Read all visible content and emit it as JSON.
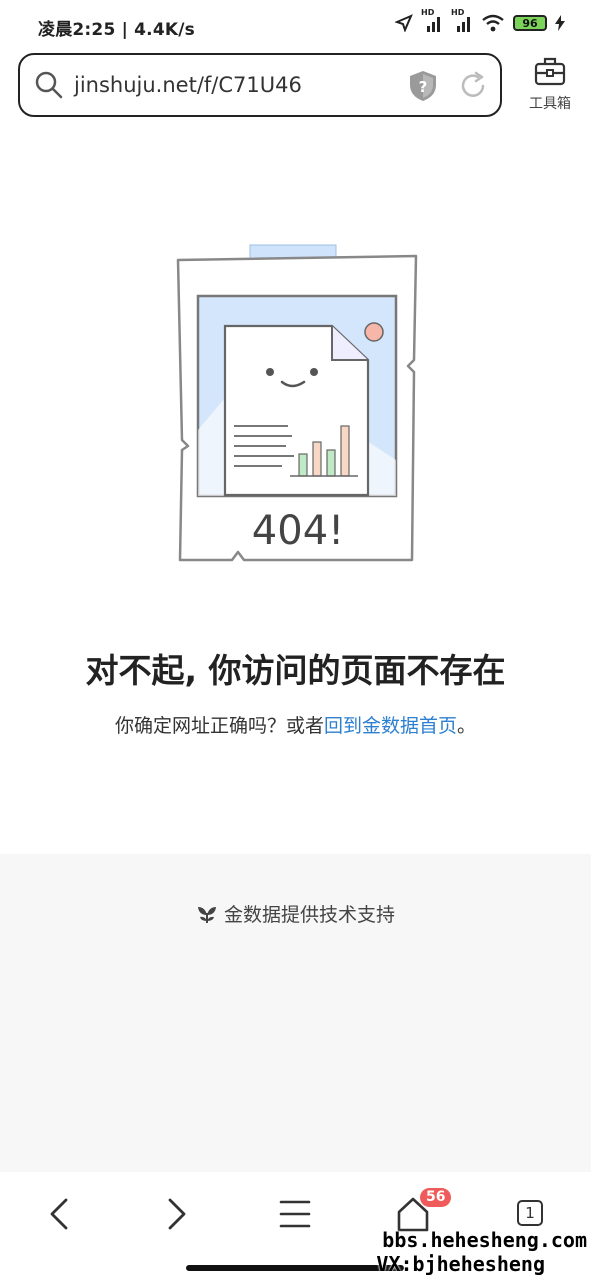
{
  "status": {
    "time": "凌晨2:25 | 4.4K/s",
    "battery": "96",
    "net_1": "HD",
    "net_2": "HD"
  },
  "address": {
    "url": "jinshuju.net/f/C71U46"
  },
  "toolbox": {
    "label": "工具箱",
    "icon": "toolbox-icon"
  },
  "illustration": {
    "code": "404!"
  },
  "error": {
    "title": "对不起, 你访问的页面不存在",
    "question": "你确定网址正确吗？或者",
    "link": "回到金数据首页",
    "suffix": "。"
  },
  "footer": {
    "powered": "金数据提供技术支持"
  },
  "nav": {
    "back_icon": "chevron-left-icon",
    "forward_icon": "chevron-right-icon",
    "menu_icon": "menu-icon",
    "home_icon": "home-icon",
    "home_badge": "56",
    "tabs_count": "1"
  },
  "watermark": {
    "line1": "bbs.hehesheng.com",
    "line2": "VX:bjhehesheng"
  },
  "colors": {
    "link": "#2d7fd1",
    "badge": "#ef5a5a",
    "battery": "#7cd35a"
  }
}
